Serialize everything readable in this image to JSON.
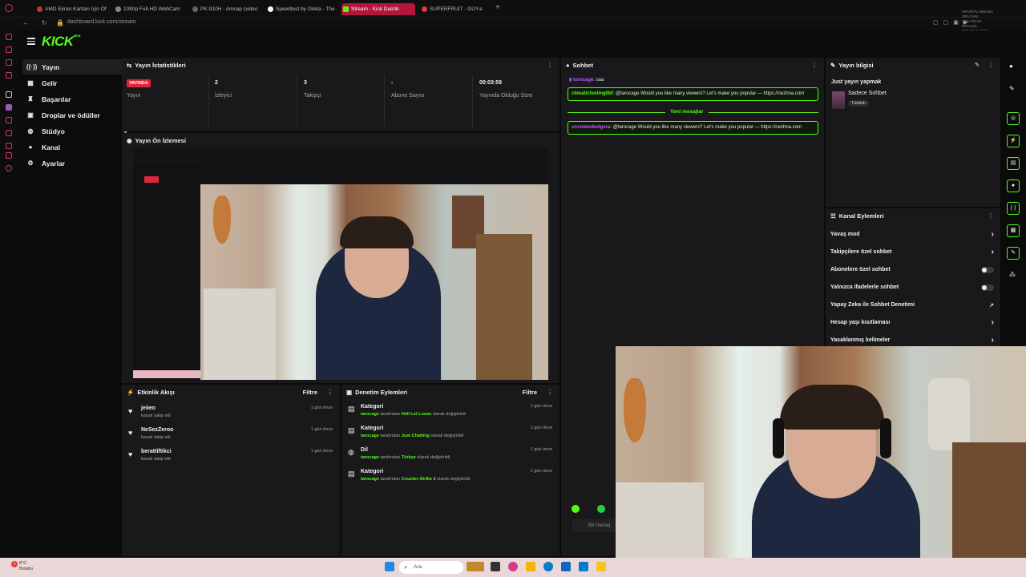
{
  "browser": {
    "tabs": [
      {
        "label": "AMD Ekran Kartları İçin Of"
      },
      {
        "label": "1080p Full-HD WebCam"
      },
      {
        "label": "PK-910H - Amcap (video"
      },
      {
        "label": "Speedtest by Ookla - The"
      },
      {
        "label": "Stream - Kick Dashb"
      },
      {
        "label": "SUPERFRUIT - GUY.e"
      }
    ],
    "url": "dashboard.kick.com/stream",
    "new_tab": "+"
  },
  "sysmon": [
    "GPU/CPU DIRAMA",
    "GPU FAN",
    "GPU SİCAK",
    "GPU KUL",
    "GPU RHD PWR",
    "GPU BCİG",
    "GPU KUL",
    "CPU TEMP"
  ],
  "header": {
    "logo": "KICK",
    "logo_beta": "BETA"
  },
  "sidebar": {
    "items": [
      {
        "label": "Yayın",
        "icon": "broadcast-icon"
      },
      {
        "label": "Gelir",
        "icon": "dollar-icon"
      },
      {
        "label": "Başarılar",
        "icon": "trophy-icon"
      },
      {
        "label": "Droplar ve ödüller",
        "icon": "gift-icon"
      },
      {
        "label": "Stüdyo",
        "icon": "palette-icon"
      },
      {
        "label": "Kanal",
        "icon": "person-icon"
      },
      {
        "label": "Ayarlar",
        "icon": "gear-icon"
      }
    ]
  },
  "stats": {
    "title": "Yayın İstatistikleri",
    "live_badge": "YAYINDA",
    "items": [
      {
        "value": "",
        "label": "Yayın"
      },
      {
        "value": "2",
        "label": "İzleyici"
      },
      {
        "value": "3",
        "label": "Takipçi"
      },
      {
        "value": "-",
        "label": "Abone Sayısı"
      },
      {
        "value": "00:03:59",
        "label": "Yayında Olduğu Süre"
      }
    ]
  },
  "preview": {
    "title": "Yayın Ön İzlemesi"
  },
  "activity": {
    "title": "Etkinlik Akışı",
    "filter": "Filtre",
    "rows": [
      {
        "name": "jeiieo",
        "sub": "kanalı takip etti",
        "time": "1 gün önce"
      },
      {
        "name": "NeSezZeroo",
        "sub": "kanalı takip etti",
        "time": "1 gün önce"
      },
      {
        "name": "berattiftikci",
        "sub": "kanalı takip etti",
        "time": "1 gün önce"
      }
    ]
  },
  "moderation": {
    "title": "Denetim Eylemleri",
    "filter": "Filtre",
    "rows": [
      {
        "title": "Kategori",
        "user": "tarocage",
        "mid": "tarafından",
        "value": "Hell Let Loose",
        "end": "olarak değiştirildi",
        "time": "1 gün önce",
        "icon": "calendar-icon"
      },
      {
        "title": "Kategori",
        "user": "tarocage",
        "mid": "tarafından",
        "value": "Just Chatting",
        "end": "olarak değiştirildi",
        "time": "1 gün önce",
        "icon": "calendar-icon"
      },
      {
        "title": "Dil",
        "user": "tarocage",
        "mid": "tarafından",
        "value": "Türkçe",
        "end": "olarak değiştirildi",
        "time": "1 gün önce",
        "icon": "globe-icon"
      },
      {
        "title": "Kategori",
        "user": "tarocage",
        "mid": "tarafından",
        "value": "Counter-Strike 2",
        "end": "olarak değiştirildi",
        "time": "1 gün önce",
        "icon": "calendar-icon"
      }
    ]
  },
  "chat": {
    "title": "Sohbet",
    "first_user": "turocage",
    "first_text": ": saa",
    "messages": [
      {
        "user": "climaticfooting0bf",
        "text": ": @tarocage Would you like many viewers? Let's make you popular — https://nezhna.com",
        "color": "#53fc18"
      },
      {
        "user": "unrelatedledgera",
        "text": ": @tarocage Would you like many viewers? Let's make you popular — https://nezhna.com",
        "color": "#b65cff"
      }
    ],
    "divider": "Yeni mesajlar",
    "input_placeholder": "Bir mesaj"
  },
  "stream_info": {
    "title": "Yayın bilgisi",
    "stream_title": "Just yayın yapmak",
    "category": "Sadece Sohbet",
    "tag": "Türkish"
  },
  "channel_actions": {
    "title": "Kanal Eylemleri",
    "rows": [
      {
        "label": "Yavaş mod",
        "control": "arrow"
      },
      {
        "label": "Takipçilere özel sohbet",
        "control": "arrow"
      },
      {
        "label": "Abonelere özel sohbet",
        "control": "toggle"
      },
      {
        "label": "Yalnızca ifadelerle sohbet",
        "control": "toggle"
      },
      {
        "label": "Yapay Zeka ile Sohbet Denetimi",
        "control": "external"
      },
      {
        "label": "Hesap yaşı kısıtlaması",
        "control": "arrow"
      },
      {
        "label": "Yasaklanmış kelimeler",
        "control": "arrow"
      }
    ]
  },
  "taskbar": {
    "weather_temp": "8°C",
    "weather_desc": "Bulutlu",
    "search": "Ara",
    "notif_count": "1"
  },
  "colors": {
    "accent": "#53fc18",
    "live": "#e0263b",
    "panel": "#19191b"
  }
}
